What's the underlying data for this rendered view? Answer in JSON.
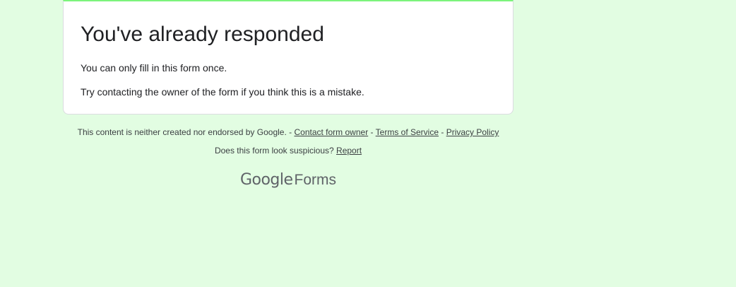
{
  "card": {
    "title": "You've already responded",
    "line_once": "You can only fill in this form once.",
    "line_mistake": "Try contacting the owner of the form if you think this is a mistake."
  },
  "footer": {
    "disclaimer": "This content is neither created nor endorsed by Google.",
    "separator": " - ",
    "contact_link": "Contact form owner",
    "terms_link": "Terms of Service",
    "privacy_link": "Privacy Policy",
    "suspicious_text": "Does this form look suspicious?",
    "report_link": "Report"
  },
  "brand": {
    "google": "Google",
    "forms": "Forms"
  },
  "colors": {
    "page_background": "#e2fde2",
    "accent_border": "#7cf47c"
  }
}
